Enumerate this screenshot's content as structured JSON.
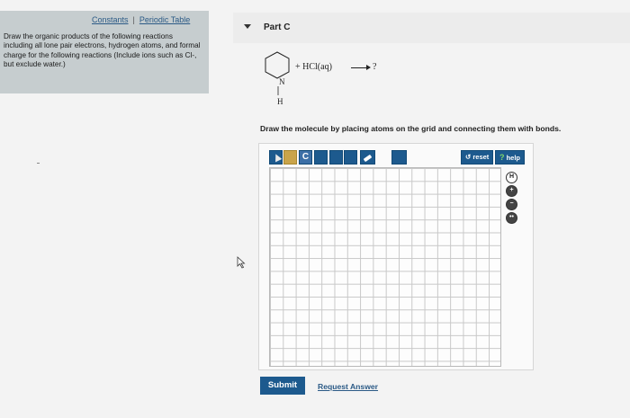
{
  "sidebar": {
    "constants_link": "Constants",
    "separator": "|",
    "periodic_table_link": "Periodic Table",
    "instructions": "Draw the organic products of the following reactions including all lone pair electrons, hydrogen atoms, and formal charge for the following reactions (Include ions such as Cl-, but exclude water.)"
  },
  "part": {
    "title": "Part C",
    "reaction_reagent": "+ HCl(aq)",
    "reaction_product": "?",
    "atom_n": "N",
    "atom_h": "H"
  },
  "editor": {
    "instruction": "Draw the molecule by placing atoms on the grid and connecting them with bonds.",
    "tools": {
      "carbon_label": "C",
      "reset_label": "reset",
      "help_label": "help",
      "help_mark": "?"
    },
    "side_tools": [
      "H",
      "+",
      "−",
      "••"
    ]
  },
  "actions": {
    "submit_label": "Submit",
    "request_answer_label": "Request Answer"
  },
  "colors": {
    "toolbar_blue": "#1d5a8e",
    "sidebar_bg": "#c6cdcf",
    "link_blue": "#2b5a86"
  }
}
